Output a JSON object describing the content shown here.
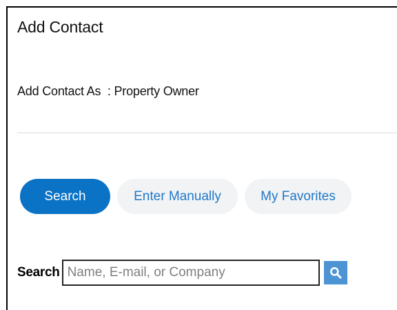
{
  "panel": {
    "title": "Add Contact",
    "add_contact_as": "Add Contact As  : Property Owner"
  },
  "tabs": [
    {
      "label": "Search",
      "active": true
    },
    {
      "label": "Enter Manually",
      "active": false
    },
    {
      "label": "My Favorites",
      "active": false
    }
  ],
  "search": {
    "label": "Search",
    "placeholder": "Name, E-mail, or Company",
    "value": "",
    "button_icon": "search-icon"
  },
  "colors": {
    "active_tab_bg": "#0b73c6",
    "inactive_tab_bg": "#f2f3f4",
    "inactive_tab_text": "#1e78c9",
    "search_button_bg": "#4c94d4"
  }
}
